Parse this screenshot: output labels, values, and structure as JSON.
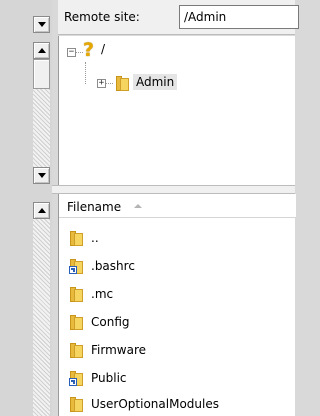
{
  "remote_site": {
    "label": "Remote site:",
    "path": "/Admin"
  },
  "tree": {
    "root_label": "/",
    "root_icon": "question-icon",
    "children": [
      {
        "label": "Admin",
        "icon": "folder-icon",
        "selected": true,
        "expander": "+"
      }
    ],
    "root_expander": "−"
  },
  "file_list": {
    "column_header": "Filename",
    "sort": "ascending",
    "items": [
      {
        "name": "..",
        "icon": "folder-icon"
      },
      {
        "name": ".bashrc",
        "icon": "folder-shortcut-icon"
      },
      {
        "name": ".mc",
        "icon": "folder-icon"
      },
      {
        "name": "Config",
        "icon": "folder-icon"
      },
      {
        "name": "Firmware",
        "icon": "folder-icon"
      },
      {
        "name": "Public",
        "icon": "folder-shortcut-icon"
      },
      {
        "name": "UserOptionalModules",
        "icon": "folder-icon"
      }
    ]
  },
  "colors": {
    "folder_yellow": "#f5d45f",
    "question_mark": "#e6a800",
    "shortcut_blue": "#2b5fb6"
  }
}
